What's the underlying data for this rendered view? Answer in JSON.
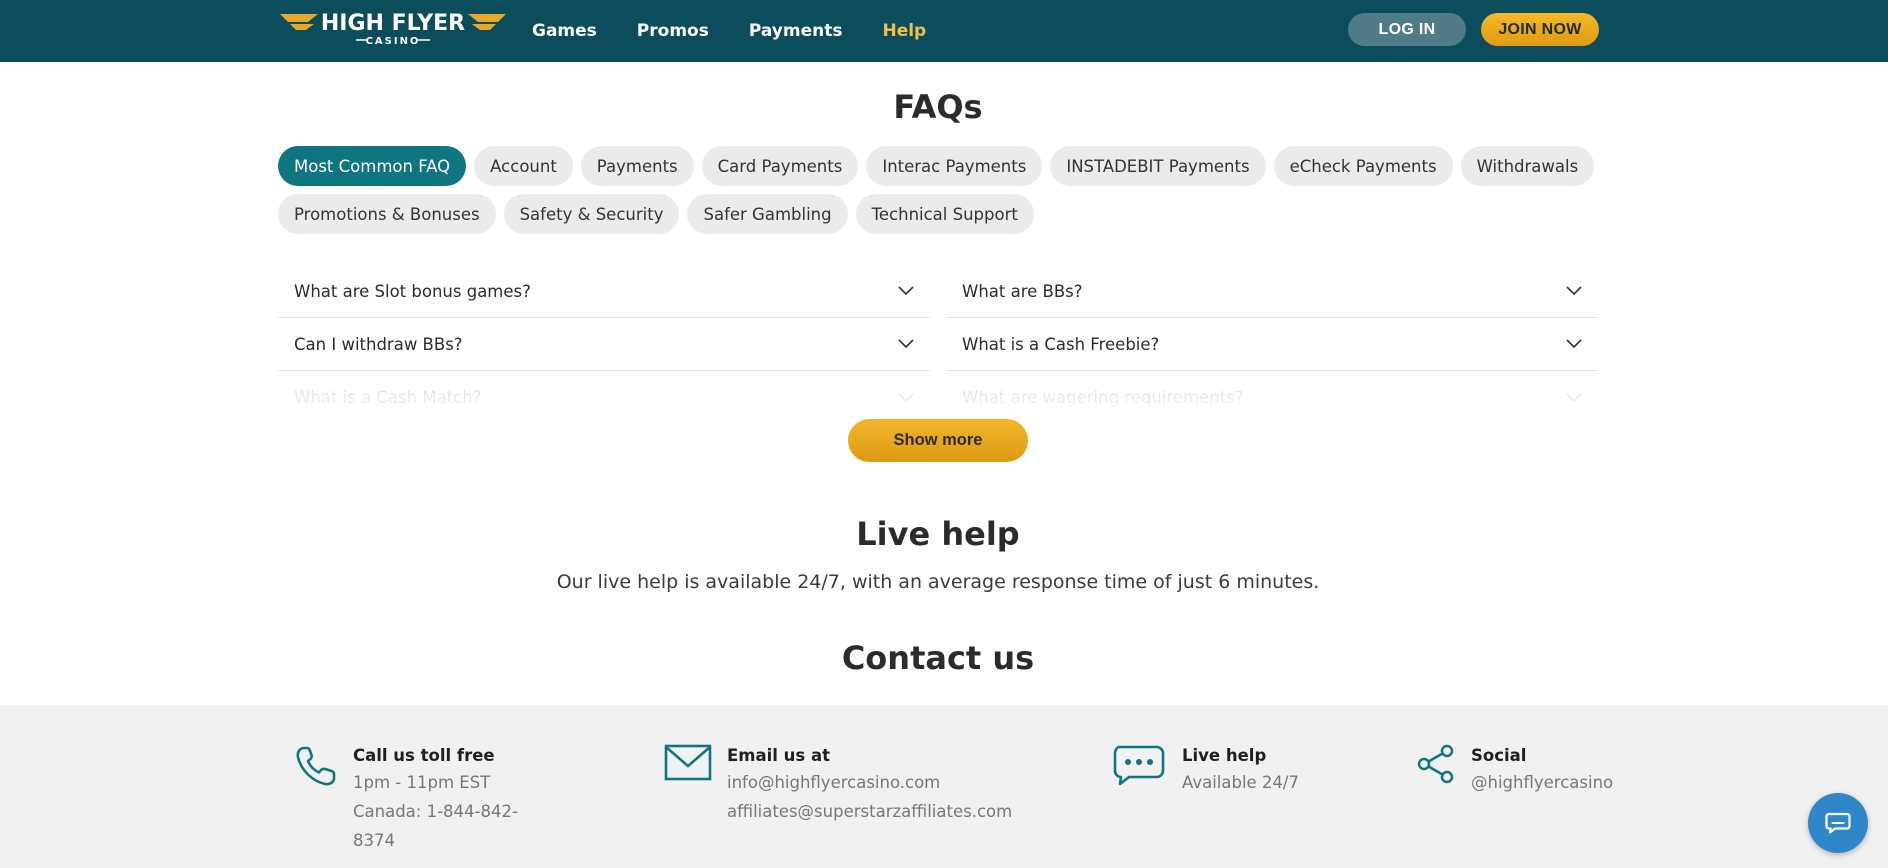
{
  "header": {
    "logo_text_top": "HIGH FLYER",
    "logo_text_bottom": "CASINO",
    "nav": [
      {
        "label": "Games"
      },
      {
        "label": "Promos"
      },
      {
        "label": "Payments"
      },
      {
        "label": "Help"
      }
    ],
    "active_nav": "Help",
    "login_label": "LOG IN",
    "join_label": "JOIN NOW"
  },
  "faq": {
    "title": "FAQs",
    "categories": [
      {
        "label": "Most Common FAQ"
      },
      {
        "label": "Account"
      },
      {
        "label": "Payments"
      },
      {
        "label": "Card Payments"
      },
      {
        "label": "Interac Payments"
      },
      {
        "label": "INSTADEBIT Payments"
      },
      {
        "label": "eCheck Payments"
      },
      {
        "label": "Withdrawals"
      },
      {
        "label": "Promotions & Bonuses"
      },
      {
        "label": "Safety & Security"
      },
      {
        "label": "Safer Gambling"
      },
      {
        "label": "Technical Support"
      }
    ],
    "active_category": "Most Common FAQ",
    "left_questions": [
      {
        "q": "What are Slot bonus games?"
      },
      {
        "q": "Can I withdraw BBs?"
      },
      {
        "q": "What is a Cash Match?"
      }
    ],
    "right_questions": [
      {
        "q": "What are BBs?"
      },
      {
        "q": "What is a Cash Freebie?"
      },
      {
        "q": "What are wagering requirements?"
      }
    ],
    "show_more_label": "Show more"
  },
  "live_help": {
    "title": "Live help",
    "text": "Our live help is available 24/7, with an average response time of just 6 minutes."
  },
  "contact": {
    "title": "Contact us",
    "phone": {
      "title": "Call us toll free",
      "line1": "1pm - 11pm EST",
      "line2": "Canada: 1-844-842-8374",
      "icon": "phone-icon"
    },
    "email": {
      "title": "Email us at",
      "line1": "info@highflyercasino.com",
      "line2": "affiliates@superstarzaffiliates.com",
      "icon": "envelope-icon"
    },
    "live": {
      "title": "Live help",
      "line1": "Available 24/7",
      "icon": "chat-bubble-icon"
    },
    "social": {
      "title": "Social",
      "line1": "@highflyercasino",
      "icon": "share-icon"
    }
  },
  "colors": {
    "header_bg": "#0c4d5c",
    "accent_teal": "#0f7580",
    "accent_gold": "#f2c04a",
    "chat_button": "#2f86c9"
  }
}
